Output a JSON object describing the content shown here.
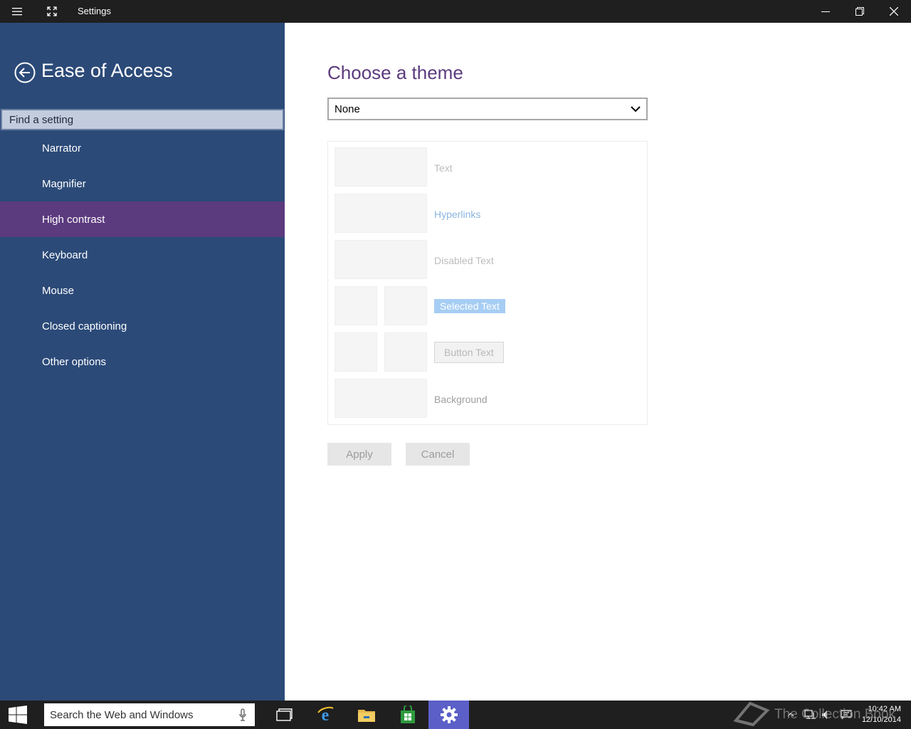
{
  "titlebar": {
    "title": "Settings"
  },
  "sidebar": {
    "title": "Ease of Access",
    "search_placeholder": "Find a setting",
    "items": [
      {
        "label": "Narrator"
      },
      {
        "label": "Magnifier"
      },
      {
        "label": "High contrast"
      },
      {
        "label": "Keyboard"
      },
      {
        "label": "Mouse"
      },
      {
        "label": "Closed captioning"
      },
      {
        "label": "Other options"
      }
    ],
    "active_item": "High contrast"
  },
  "main": {
    "title": "Choose a theme",
    "theme_select": {
      "value": "None"
    },
    "preview": {
      "text": "Text",
      "hyperlinks": "Hyperlinks",
      "disabled_text": "Disabled Text",
      "selected_text": "Selected Text",
      "button_text": "Button Text",
      "background": "Background"
    },
    "apply_label": "Apply",
    "cancel_label": "Cancel"
  },
  "taskbar": {
    "search_placeholder": "Search the Web and Windows",
    "apps": [
      "task-view",
      "internet-explorer",
      "file-explorer",
      "store",
      "settings"
    ],
    "active_app": "settings",
    "time": "10:42 AM",
    "date": "12/10/2014"
  },
  "watermark": {
    "text": "The Collection Book"
  },
  "colors": {
    "sidebar_bg": "#2b4a78",
    "active_item_bg": "#5b3a7e",
    "title_color": "#5b3a7e",
    "taskbar_bg": "#1f1f1f"
  }
}
